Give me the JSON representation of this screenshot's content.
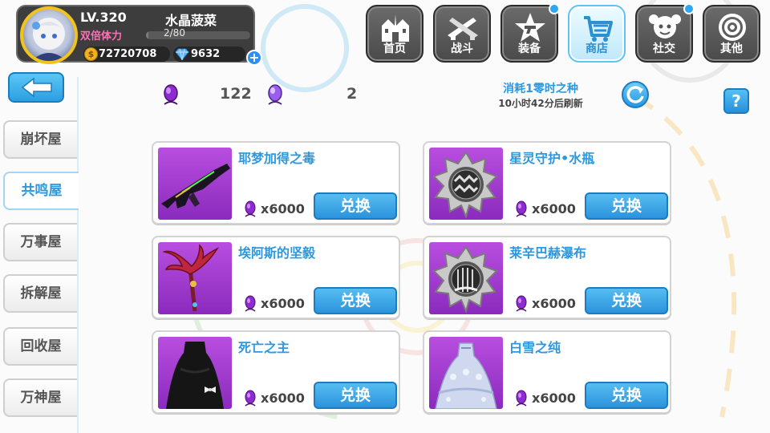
{
  "player": {
    "level": "LV.320",
    "name": "水晶菠菜",
    "stamina_label": "双倍体力",
    "stamina": "2/80",
    "stamina_fraction": 0.025,
    "gold": "72720708",
    "crystals": "9632"
  },
  "nav": [
    {
      "label": "首页",
      "icon": "castle-icon"
    },
    {
      "label": "战斗",
      "icon": "crossed-guns-icon"
    },
    {
      "label": "装备",
      "icon": "star-gun-icon",
      "badge": true
    },
    {
      "label": "商店",
      "icon": "shop-basket-icon",
      "active": true
    },
    {
      "label": "社交",
      "icon": "social-face-icon",
      "badge": true
    },
    {
      "label": "其他",
      "icon": "target-icon"
    }
  ],
  "sidebar": [
    {
      "label": "崩坏屋"
    },
    {
      "label": "共鸣屋",
      "active": true
    },
    {
      "label": "万事屋"
    },
    {
      "label": "拆解屋"
    },
    {
      "label": "回收屋"
    },
    {
      "label": "万神屋"
    }
  ],
  "resources": [
    {
      "icon": "purple-seed-icon",
      "value": "122"
    },
    {
      "icon": "violet-seed-icon",
      "value": "2"
    }
  ],
  "refresh": {
    "label": "消耗1零时之种",
    "time": "10小时42分后刷新"
  },
  "help_label": "?",
  "redeem_label": "兑换",
  "items": [
    {
      "name": "耶梦加得之毒",
      "cost": "x6000",
      "thumb": "rifle-thumb"
    },
    {
      "name": "星灵守护•水瓶",
      "cost": "x6000",
      "thumb": "aquarius-badge-thumb"
    },
    {
      "name": "埃阿斯的坚毅",
      "cost": "x6000",
      "thumb": "phoenix-staff-thumb"
    },
    {
      "name": "莱辛巴赫瀑布",
      "cost": "x6000",
      "thumb": "waterfall-badge-thumb"
    },
    {
      "name": "死亡之主",
      "cost": "x6000",
      "thumb": "black-dress-thumb"
    },
    {
      "name": "白雪之纯",
      "cost": "x6000",
      "thumb": "white-dress-thumb"
    }
  ],
  "colors": {
    "accent": "#2f97dc",
    "stamina": "#ff6fb4",
    "thumb_bg": "#a63ed3",
    "gold": "#f0b422"
  }
}
